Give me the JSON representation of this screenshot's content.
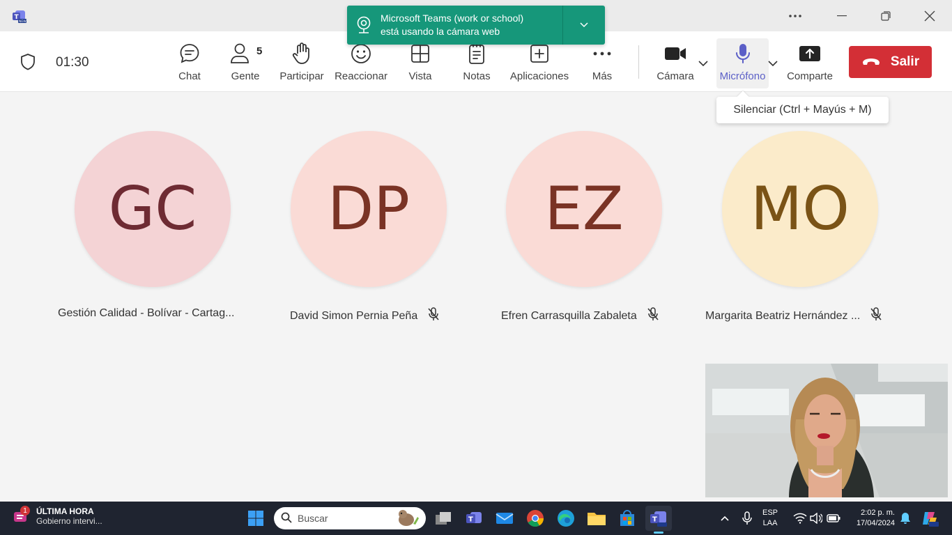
{
  "toast": {
    "line1": "Microsoft Teams (work or school)",
    "line2": "está usando la cámara web"
  },
  "meeting": {
    "timer": "01:30",
    "people_count": "5",
    "tools": {
      "chat": "Chat",
      "people": "Gente",
      "raise": "Participar",
      "react": "Reaccionar",
      "view": "Vista",
      "notes": "Notas",
      "apps": "Aplicaciones",
      "more": "Más",
      "camera": "Cámara",
      "mic": "Micrófono",
      "share": "Comparte"
    },
    "leave_label": "Salir",
    "mic_tooltip": "Silenciar (Ctrl + Mayús + M)"
  },
  "participants": [
    {
      "initials": "GC",
      "name": "Gestión Calidad - Bolívar - Cartag...",
      "muted": false,
      "bg": "#f4d3d5",
      "fg": "#6e2b33"
    },
    {
      "initials": "DP",
      "name": "David Simon Pernia Peña",
      "muted": true,
      "bg": "#fadbd6",
      "fg": "#7a3325"
    },
    {
      "initials": "EZ",
      "name": "Efren Carrasquilla Zabaleta",
      "muted": true,
      "bg": "#fadbd6",
      "fg": "#7a3325"
    },
    {
      "initials": "MO",
      "name": "Margarita Beatriz Hernández ...",
      "muted": true,
      "bg": "#fbebca",
      "fg": "#7a5316"
    }
  ],
  "taskbar": {
    "news_badge": "1",
    "news_title": "ÚLTIMA HORA",
    "news_sub": "Gobierno intervi...",
    "search_placeholder": "Buscar",
    "lang1": "ESP",
    "lang2": "LAA",
    "time": "2:02 p. m.",
    "date": "17/04/2024"
  },
  "colors": {
    "accent": "#5b5fc7",
    "leave": "#d32f36",
    "toast": "#16977a",
    "taskbar": "#1f2430"
  }
}
